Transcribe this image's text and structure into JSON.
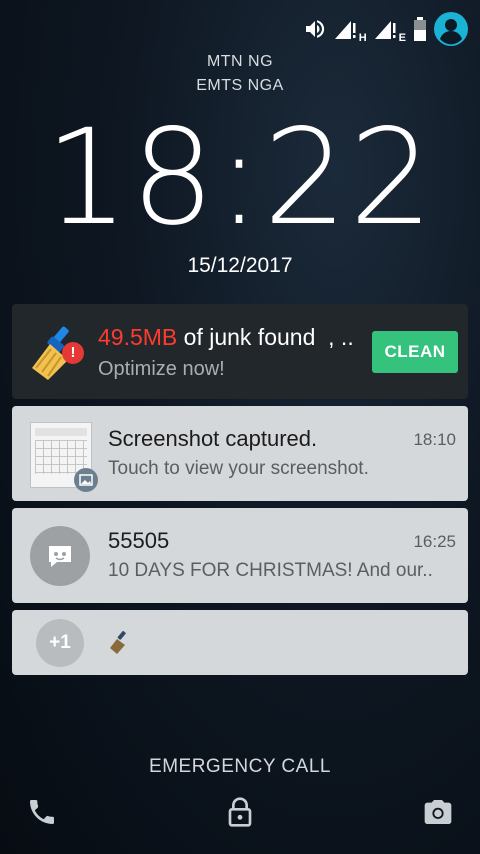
{
  "status_bar": {
    "network_type_1": "H",
    "network_type_2": "E"
  },
  "carriers": {
    "sim1": "MTN NG",
    "sim2": "EMTS NGA"
  },
  "clock": {
    "time": "18:22"
  },
  "date": "15/12/2017",
  "notifications": {
    "clean": {
      "size": "49.5MB",
      "title_rest": " of junk found  , ..",
      "subtitle": "Optimize now!",
      "button_label": "CLEAN"
    },
    "screenshot": {
      "title": "Screenshot captured.",
      "text": "Touch to view your screenshot.",
      "time": "18:10"
    },
    "sms": {
      "title": "55505",
      "text": "10 DAYS FOR CHRISTMAS! And our..",
      "time": "16:25"
    },
    "more": {
      "count": "+1"
    }
  },
  "emergency_call": "EMERGENCY CALL",
  "colors": {
    "accent_green": "#35c27c",
    "junk_red": "#ff3b30",
    "profile_cyan": "#1ab3d6"
  }
}
